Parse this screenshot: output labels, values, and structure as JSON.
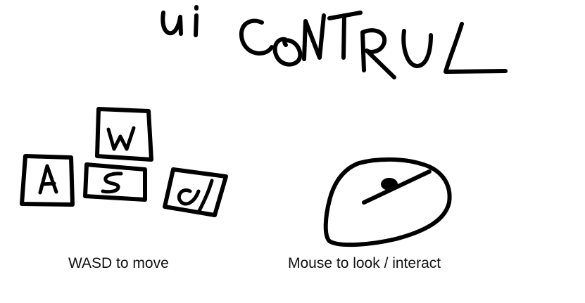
{
  "title": "ui CONTRUL",
  "keys": {
    "w": "W",
    "a": "A",
    "s": "S",
    "d": "D"
  },
  "captions": {
    "move": "WASD to move",
    "look": "Mouse to look / interact"
  },
  "colors": {
    "ink": "#000000",
    "background": "#ffffff"
  },
  "icons": [
    "wasd-keys-icon",
    "mouse-icon"
  ]
}
